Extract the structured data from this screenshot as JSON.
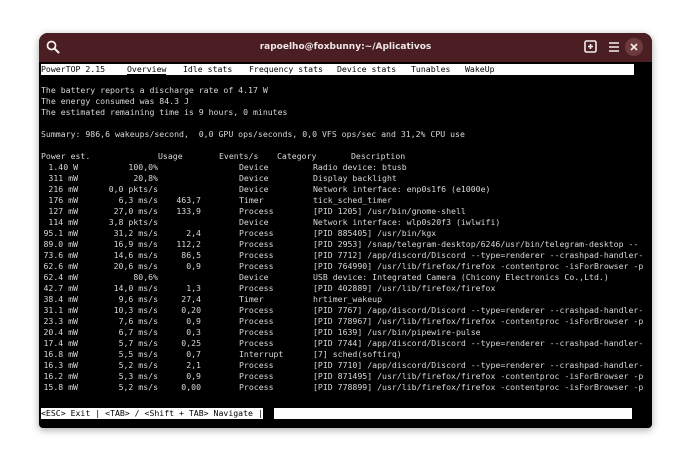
{
  "window": {
    "title": "rapoelho@foxbunny:~/Aplicativos"
  },
  "titlebar_icons": {
    "search": "search-icon",
    "new_tab": "new-tab-icon",
    "close": "close-icon"
  },
  "app_name": "PowerTOP 2.15",
  "tabs": [
    "Overview",
    "Idle stats",
    "Frequency stats",
    "Device stats",
    "Tunables",
    "WakeUp"
  ],
  "active_tab": "Overview",
  "battery": {
    "discharge": "The battery reports a discharge rate of 4.17 W",
    "energy": "The energy consumed was 84.3 J",
    "remaining": "The estimated remaining time is 9 hours, 0 minutes"
  },
  "summary": "Summary: 986,6 wakeups/second,  0,0 GPU ops/seconds, 0,0 VFS ops/sec and 31,2% CPU use",
  "table": {
    "headers": [
      "Power est.",
      "Usage",
      "Events/s",
      "Category",
      "Description"
    ],
    "rows": [
      [
        "1.40 W",
        "100,0%",
        "",
        "Device",
        "Radio device: btusb"
      ],
      [
        "311 mW",
        "20,8%",
        "",
        "Device",
        "Display backlight"
      ],
      [
        "216 mW",
        "0,0 pkts/s",
        "",
        "Device",
        "Network interface: enp0s1f6 (e1000e)"
      ],
      [
        "176 mW",
        "6,3 ms/s",
        "463,7",
        "Timer",
        "tick_sched_timer"
      ],
      [
        "127 mW",
        "27,0 ms/s",
        "133,9",
        "Process",
        "[PID 1205] /usr/bin/gnome-shell"
      ],
      [
        "114 mW",
        "3,8 pkts/s",
        "",
        "Device",
        "Network interface: wlp0s20f3 (iwlwifi)"
      ],
      [
        "95.1 mW",
        "31,2 ms/s",
        "2,4",
        "Process",
        "[PID 885405] /usr/bin/kgx"
      ],
      [
        "89.0 mW",
        "16,9 ms/s",
        "112,2",
        "Process",
        "[PID 2953] /snap/telegram-desktop/6246/usr/bin/telegram-desktop --"
      ],
      [
        "73.6 mW",
        "14,6 ms/s",
        "86,5",
        "Process",
        "[PID 7712] /app/discord/Discord --type=renderer --crashpad-handler-"
      ],
      [
        "62.6 mW",
        "20,6 ms/s",
        "0,9",
        "Process",
        "[PID 764990] /usr/lib/firefox/firefox -contentproc -isForBrowser -p"
      ],
      [
        "62.4 mW",
        "80,6%",
        "",
        "Device",
        "USB device: Integrated Camera (Chicony Electronics Co.,Ltd.)"
      ],
      [
        "42.7 mW",
        "14,0 ms/s",
        "1,3",
        "Process",
        "[PID 402889] /usr/lib/firefox/firefox"
      ],
      [
        "38.4 mW",
        "9,6 ms/s",
        "27,4",
        "Timer",
        "hrtimer_wakeup"
      ],
      [
        "31.1 mW",
        "10,3 ms/s",
        "0,20",
        "Process",
        "[PID 7767] /app/discord/Discord --type=renderer --crashpad-handler-"
      ],
      [
        "23.3 mW",
        "7,6 ms/s",
        "0,9",
        "Process",
        "[PID 778967] /usr/lib/firefox/firefox -contentproc -isForBrowser -p"
      ],
      [
        "20.4 mW",
        "6,7 ms/s",
        "0,3",
        "Process",
        "[PID 1639] /usr/bin/pipewire-pulse"
      ],
      [
        "17.4 mW",
        "5,7 ms/s",
        "0,25",
        "Process",
        "[PID 7744] /app/discord/Discord --type=renderer --crashpad-handler-"
      ],
      [
        "16.8 mW",
        "5,5 ms/s",
        "0,7",
        "Interrupt",
        "[7] sched(softirq)"
      ],
      [
        "16.3 mW",
        "5,2 ms/s",
        "2,1",
        "Process",
        "[PID 7710] /app/discord/Discord --type=renderer --crashpad-handler-"
      ],
      [
        "16.2 mW",
        "5,3 ms/s",
        "0,9",
        "Process",
        "[PID 871495] /usr/lib/firefox/firefox -contentproc -isForBrowser -p"
      ],
      [
        "15.8 mW",
        "5,2 ms/s",
        "0,00",
        "Process",
        "[PID 778899] /usr/lib/firefox/firefox -contentproc -isForBrowser -p"
      ]
    ]
  },
  "status_bar": "<ESC> Exit | <TAB> / <Shift + TAB> Navigate |",
  "colors": {
    "titlebar": "#4a1e22",
    "terminal_bg": "#000000",
    "terminal_fg": "#d8d8d8",
    "bar_bg": "#ffffff"
  }
}
